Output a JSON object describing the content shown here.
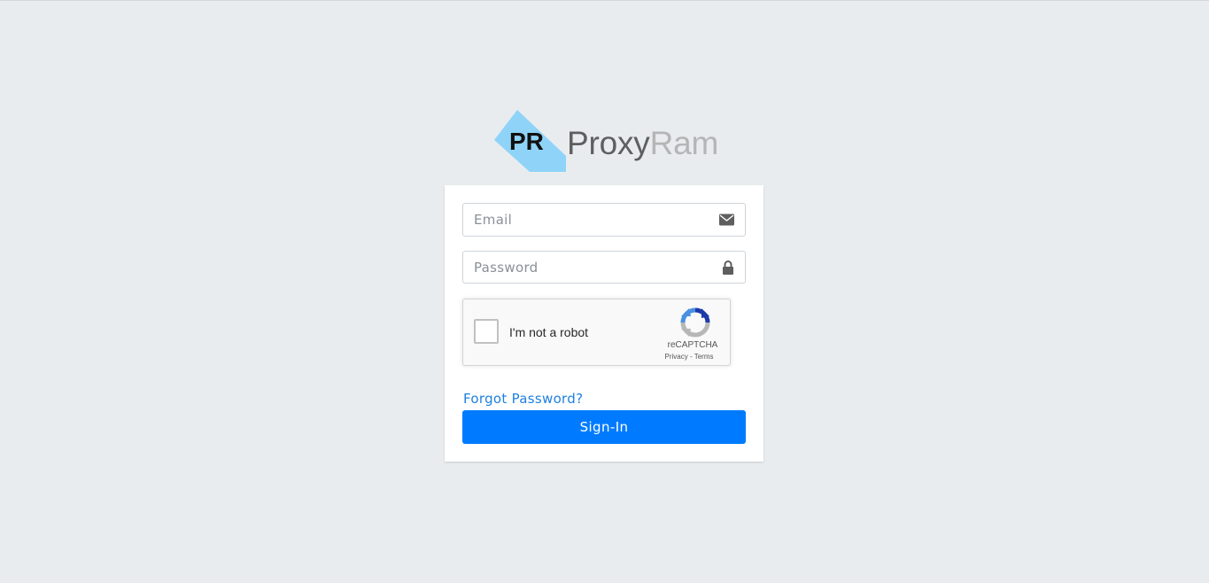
{
  "brand": {
    "logo_mark": "PR",
    "name_part1": "Proxy",
    "name_part2": "Ram",
    "colors": {
      "mark_bg": "#8fd4f8",
      "mark_text": "#111111",
      "name_part1": "#5f5f5f",
      "name_part2": "#b5b5b5"
    }
  },
  "form": {
    "email_placeholder": "Email",
    "email_value": "",
    "email_icon": "envelope-icon",
    "password_placeholder": "Password",
    "password_value": "",
    "password_icon": "lock-icon",
    "captcha": {
      "label": "I'm not a robot",
      "brand": "reCAPTCHA",
      "privacy": "Privacy",
      "separator": " - ",
      "terms": "Terms",
      "checked": false
    },
    "forgot_password": "Forgot Password?",
    "submit_label": "Sign-In"
  },
  "colors": {
    "page_bg": "#e9ecef",
    "primary": "#007bff",
    "link": "#1f7fe0"
  }
}
